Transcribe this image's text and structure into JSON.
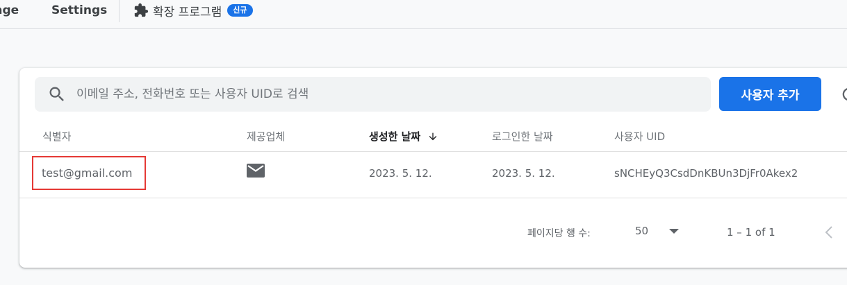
{
  "topbar": {
    "tabs": [
      {
        "label": "age"
      },
      {
        "label": "Settings"
      },
      {
        "label": "확장 프로그램",
        "badge": "신규",
        "icon": "extension-icon"
      }
    ]
  },
  "search": {
    "placeholder": "이메일 주소, 전화번호 또는 사용자 UID로 검색",
    "icon": "search-icon"
  },
  "add_user_label": "사용자 추가",
  "table": {
    "columns": [
      "식별자",
      "제공업체",
      "생성한 날짜",
      "로그인한 날짜",
      "사용자 UID"
    ],
    "sorted_column": "생성한 날짜",
    "rows": [
      {
        "identifier": "test@gmail.com",
        "provider_icon": "mail-icon",
        "created": "2023. 5. 12.",
        "signed_in": "2023. 5. 12.",
        "uid": "sNCHEyQ3CsdDnKBUn3DjFr0Akex2"
      }
    ]
  },
  "pagination": {
    "rows_per_page_label": "페이지당 행 수:",
    "rows_per_page": "50",
    "range": "1 – 1 of 1"
  },
  "colors": {
    "accent": "#1a73e8",
    "highlight_border": "#e53935"
  }
}
